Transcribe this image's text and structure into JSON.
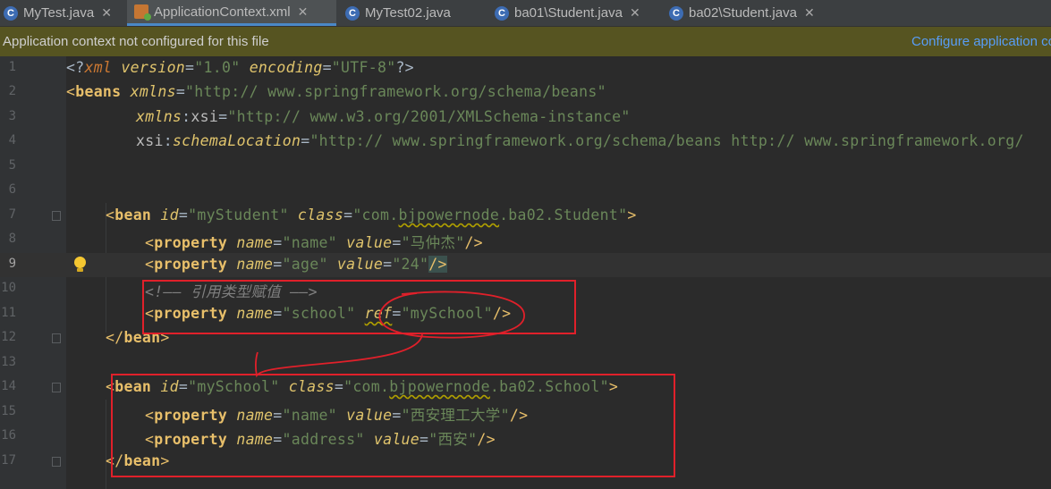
{
  "tabs": [
    {
      "label": "MyTest.java",
      "icon": "java-class-icon",
      "active": false
    },
    {
      "label": "ApplicationContext.xml",
      "icon": "xml-file-icon",
      "active": true
    },
    {
      "label": "MyTest02.java",
      "icon": "java-class-icon",
      "active": false
    },
    {
      "label": "ba01\\Student.java",
      "icon": "java-class-icon",
      "active": false
    },
    {
      "label": "ba02\\Student.java",
      "icon": "java-class-icon",
      "active": false
    }
  ],
  "close_glyph": "✕",
  "banner": {
    "message": "Application context not configured for this file",
    "action": "Configure application context"
  },
  "editor": {
    "current_line": 9,
    "line_numbers": [
      "1",
      "2",
      "3",
      "4",
      "5",
      "6",
      "7",
      "8",
      "9",
      "10",
      "11",
      "12",
      "13",
      "14",
      "15",
      "16",
      "17"
    ],
    "lines": {
      "l1": {
        "decl_open": "<?",
        "decl_name": "xml",
        "version_attr": "version",
        "version_val": "\"1.0\"",
        "enc_attr": "encoding",
        "enc_val": "\"UTF-8\"",
        "decl_close": "?>"
      },
      "l2": {
        "tag": "beans",
        "attr": "xmlns",
        "val": "\"http:// www.springframework.org/schema/beans\""
      },
      "l3": {
        "ns": "xmlns",
        "attr": "xsi",
        "val": "\"http:// www.w3.org/2001/XMLSchema-instance\""
      },
      "l4": {
        "ns": "xsi",
        "attr": "schemaLocation",
        "val": "\"http:// www.springframework.org/schema/beans http:// www.springframework.org/"
      },
      "l7": {
        "tag": "bean",
        "id_attr": "id",
        "id_val": "\"myStudent\"",
        "class_attr": "class",
        "class_val_a": "\"com.",
        "class_val_b": "bjpowernode",
        "class_val_c": ".ba02.Student\""
      },
      "l8": {
        "tag": "property",
        "name_attr": "name",
        "name_val": "\"name\"",
        "value_attr": "value",
        "value_val": "\"马仲杰\""
      },
      "l9": {
        "tag": "property",
        "name_attr": "name",
        "name_val": "\"age\"",
        "value_attr": "value",
        "value_val": "\"24\""
      },
      "l10": {
        "comment": "<!—— 引用类型赋值 ——>"
      },
      "l11": {
        "tag": "property",
        "name_attr": "name",
        "name_val": "\"school\"",
        "ref_attr": "ref",
        "ref_val": "\"mySchool\""
      },
      "l12": {
        "close": "bean"
      },
      "l14": {
        "tag": "bean",
        "id_attr": "id",
        "id_val": "\"mySchool\"",
        "class_attr": "class",
        "class_val_a": "\"com.",
        "class_val_b": "bjpowernode",
        "class_val_c": ".ba02.School\""
      },
      "l15": {
        "tag": "property",
        "name_attr": "name",
        "name_val": "\"name\"",
        "value_attr": "value",
        "value_val": "\"西安理工大学\""
      },
      "l16": {
        "tag": "property",
        "name_attr": "name",
        "name_val": "\"address\"",
        "value_attr": "value",
        "value_val": "\"西安\""
      },
      "l17": {
        "close": "bean"
      }
    }
  },
  "colors": {
    "annotation": "#e0202a",
    "tag": "#e8bf6a",
    "string": "#6a8759",
    "attribute_italic": "#e0c46c",
    "keyword": "#cc7832"
  }
}
